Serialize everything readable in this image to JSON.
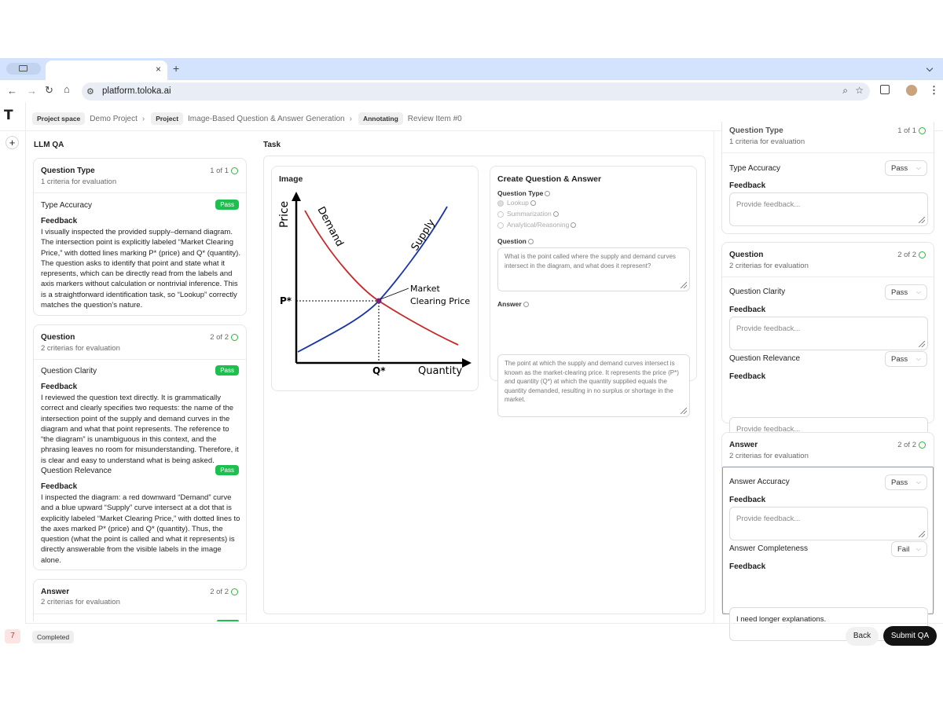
{
  "browser": {
    "url": "platform.toloka.ai",
    "new_tab": "+",
    "tab_close": "×"
  },
  "rail": {
    "logo": "T",
    "add": "+",
    "badge": "7"
  },
  "breadcrumb": {
    "project_space_chip": "Project space",
    "project_space": "Demo Project",
    "project_chip": "Project",
    "project": "Image-Based Question & Answer Generation",
    "status_chip": "Annotating",
    "item": "Review Item #0"
  },
  "left_panel": {
    "title": "LLM QA",
    "sections": [
      {
        "title": "Question Type",
        "sub": "1 criteria for evaluation",
        "count": "1 of 1",
        "criteria": [
          {
            "name": "Type Accuracy",
            "status": "Pass",
            "feedback_label": "Feedback",
            "feedback": "I visually inspected the provided supply–demand diagram. The intersection point is explicitly labeled “Market Clearing Price,” with dotted lines marking P* (price) and Q* (quantity). The question asks to identify that point and state what it represents, which can be directly read from the labels and axis markers without calculation or nontrivial inference. This is a straightforward identification task, so “Lookup” correctly matches the question’s nature."
          }
        ]
      },
      {
        "title": "Question",
        "sub": "2 criterias for evaluation",
        "count": "2 of 2",
        "criteria": [
          {
            "name": "Question Clarity",
            "status": "Pass",
            "feedback_label": "Feedback",
            "feedback": "I reviewed the question text directly. It is grammatically correct and clearly specifies two requests: the name of the intersection point of the supply and demand curves in the diagram and what that point represents. The reference to “the diagram” is unambiguous in this context, and the phrasing leaves no room for misunderstanding. Therefore, it is clear and easy to understand what is being asked."
          },
          {
            "name": "Question Relevance",
            "status": "Pass",
            "feedback_label": "Feedback",
            "feedback": "I inspected the diagram: a red downward “Demand” curve and a blue upward “Supply” curve intersect at a dot that is explicitly labeled “Market Clearing Price,” with dotted lines to the axes marked P* (price) and Q* (quantity). Thus, the question (what the point is called and what it represents) is directly answerable from the visible labels in the image alone."
          }
        ]
      },
      {
        "title": "Answer",
        "sub": "2 criterias for evaluation",
        "count": "2 of 2"
      }
    ]
  },
  "task": {
    "title": "Task",
    "image_card": {
      "title": "Image",
      "labels": {
        "price": "Price",
        "quantity": "Quantity",
        "demand": "Demand",
        "supply": "Supply",
        "market1": "Market",
        "market2": "Clearing Price",
        "p": "P*",
        "q": "Q*"
      }
    },
    "form": {
      "title": "Create Question & Answer",
      "question_type_label": "Question Type",
      "options": [
        "Lookup",
        "Summarization",
        "Analytical/Reasoning"
      ],
      "question_label": "Question",
      "question_text": "What is the point called where the supply and demand curves intersect in the diagram, and what does it represent?",
      "answer_label": "Answer",
      "answer_text": "The point at which the supply and demand curves intersect is known as the market-clearing price. It represents the price (P*) and quantity (Q*) at which the quantity supplied equals the quantity demanded, resulting in no surplus or shortage in the market."
    }
  },
  "right_panel": {
    "top_title": "Question Type",
    "top_count": "1 of 1",
    "top_sub": "1 criteria for evaluation",
    "type_accuracy": "Type Accuracy",
    "type_accuracy_value": "Pass",
    "feedback_label": "Feedback",
    "placeholder": "Provide feedback...",
    "question_title": "Question",
    "question_sub": "2 criterias for evaluation",
    "question_count": "2 of 2",
    "clarity": "Question Clarity",
    "clarity_value": "Pass",
    "relevance": "Question Relevance",
    "relevance_value": "Pass",
    "answer_title": "Answer",
    "answer_sub": "2 criterias for evaluation",
    "answer_count": "2 of 2",
    "accuracy": "Answer Accuracy",
    "accuracy_value": "Pass",
    "completeness": "Answer Completeness",
    "completeness_value": "Fail",
    "completeness_feedback": "I need longer explanations."
  },
  "footer": {
    "status": "Completed",
    "back": "Back",
    "submit": "Submit QA"
  }
}
